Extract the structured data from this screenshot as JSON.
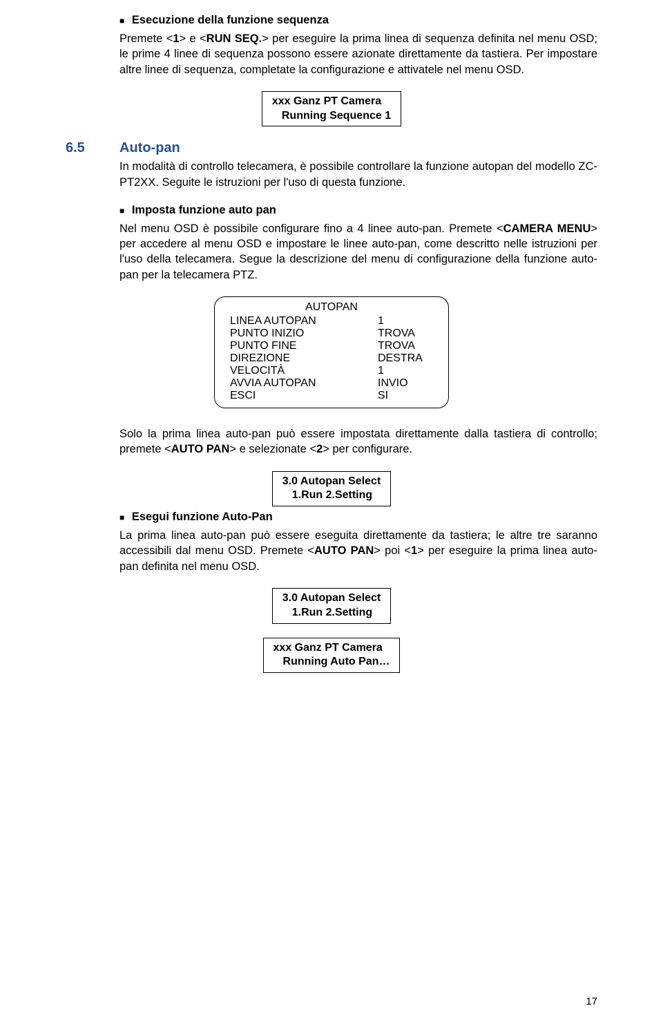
{
  "topSection": {
    "title": "Esecuzione della funzione sequenza",
    "paragraph_before": "Premete <",
    "b1": "1",
    "paragraph_mid1": "> e <",
    "b2": "RUN SEQ.",
    "paragraph_after": "> per eseguire la prima linea di sequenza definita nel menu OSD; le prime 4 linee di sequenza possono essere azionate direttamente da tastiera. Per impostare altre linee di sequenza, completate la configurazione e attivatele nel menu OSD."
  },
  "lcd1": {
    "line1": "xxx Ganz PT Camera",
    "line2": "Running Sequence 1"
  },
  "heading": {
    "num": "6.5",
    "title": "Auto-pan",
    "para": "In modalità di controllo telecamera, è possibile controllare la funzione autopan del modello ZC-PT2XX. Seguite le istruzioni per l'uso di questa funzione."
  },
  "sec2": {
    "title": "Imposta funzione auto pan",
    "para_before": "Nel menu OSD è possibile configurare fino a 4 linee auto-pan. Premete <",
    "b1": "CAMERA MENU",
    "para_after": "> per accedere al menu OSD e impostare le linee auto-pan, come descritto nelle istruzioni per l'uso della telecamera. Segue la descrizione del menu di configurazione della funzione auto-pan per la telecamera PTZ."
  },
  "menu": {
    "title": "AUTOPAN",
    "rows": [
      {
        "k": "LINEA AUTOPAN",
        "v": "1"
      },
      {
        "k": "PUNTO INIZIO",
        "v": "TROVA"
      },
      {
        "k": "PUNTO FINE",
        "v": "TROVA"
      },
      {
        "k": "DIREZIONE",
        "v": "DESTRA"
      },
      {
        "k": "VELOCITÀ",
        "v": "1"
      },
      {
        "k": "AVVIA AUTOPAN",
        "v": "INVIO"
      },
      {
        "k": "ESCI",
        "v": "SI"
      }
    ]
  },
  "sec3": {
    "p_before": "Solo la prima linea auto-pan può essere impostata direttamente dalla tastiera di controllo; premete <",
    "b1": "AUTO PAN",
    "p_mid": "> e selezionate <",
    "b2": "2",
    "p_after": "> per configurare."
  },
  "lcd2": {
    "line1": "3.0 Autopan Select",
    "line2": "1.Run   2.Setting"
  },
  "sec4": {
    "title": "Esegui funzione Auto-Pan",
    "p_before": "La prima linea auto-pan può essere eseguita direttamente da tastiera; le altre tre saranno accessibili dal menu OSD. Premete <",
    "b1": "AUTO PAN",
    "p_mid": "> poi <",
    "b2": "1",
    "p_after": "> per eseguire la prima linea auto-pan definita nel menu OSD."
  },
  "lcd3": {
    "line1": "3.0 Autopan Select",
    "line2": "1.Run   2.Setting"
  },
  "lcd4": {
    "line1": "xxx Ganz PT Camera",
    "line2": "Running Auto Pan…"
  },
  "pageNumber": "17"
}
